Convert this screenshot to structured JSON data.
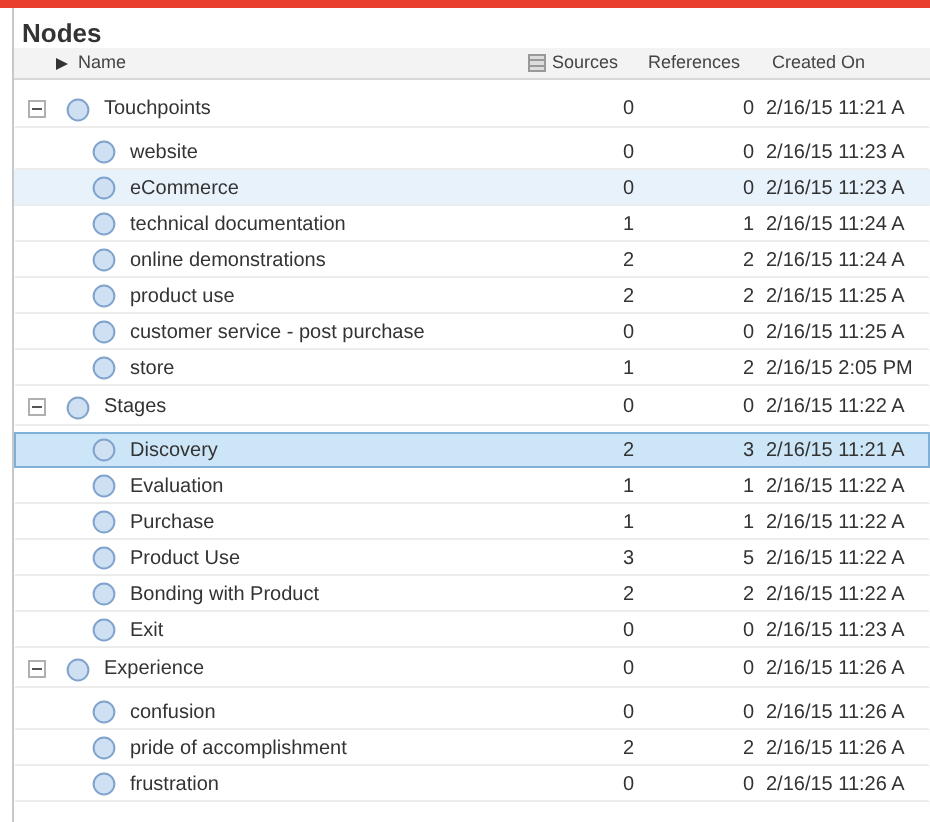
{
  "title": "Nodes",
  "columns": [
    {
      "label": "Name",
      "sorted": true
    },
    {
      "label": "Sources",
      "sorted": false
    },
    {
      "label": "References",
      "sorted": false
    },
    {
      "label": "Created On",
      "sorted": false
    }
  ],
  "groups": [
    {
      "name": "Touchpoints",
      "sources": "0",
      "references": "0",
      "created": "2/16/15 11:21 A",
      "expanded": true,
      "selected": false,
      "hovered": false,
      "children": [
        {
          "name": "website",
          "sources": "0",
          "references": "0",
          "created": "2/16/15 11:23 A",
          "selected": false,
          "hovered": false
        },
        {
          "name": "eCommerce",
          "sources": "0",
          "references": "0",
          "created": "2/16/15 11:23 A",
          "selected": false,
          "hovered": true
        },
        {
          "name": "technical documentation",
          "sources": "1",
          "references": "1",
          "created": "2/16/15 11:24 A",
          "selected": false,
          "hovered": false
        },
        {
          "name": "online demonstrations",
          "sources": "2",
          "references": "2",
          "created": "2/16/15 11:24 A",
          "selected": false,
          "hovered": false
        },
        {
          "name": "product use",
          "sources": "2",
          "references": "2",
          "created": "2/16/15 11:25 A",
          "selected": false,
          "hovered": false
        },
        {
          "name": "customer service - post purchase",
          "sources": "0",
          "references": "0",
          "created": "2/16/15 11:25 A",
          "selected": false,
          "hovered": false
        },
        {
          "name": "store",
          "sources": "1",
          "references": "2",
          "created": "2/16/15 2:05 PM",
          "selected": false,
          "hovered": false
        }
      ]
    },
    {
      "name": "Stages",
      "sources": "0",
      "references": "0",
      "created": "2/16/15 11:22 A",
      "expanded": true,
      "selected": false,
      "hovered": false,
      "children": [
        {
          "name": "Discovery",
          "sources": "2",
          "references": "3",
          "created": "2/16/15 11:21 A",
          "selected": true,
          "hovered": false
        },
        {
          "name": "Evaluation",
          "sources": "1",
          "references": "1",
          "created": "2/16/15 11:22 A",
          "selected": false,
          "hovered": false
        },
        {
          "name": "Purchase",
          "sources": "1",
          "references": "1",
          "created": "2/16/15 11:22 A",
          "selected": false,
          "hovered": false
        },
        {
          "name": "Product Use",
          "sources": "3",
          "references": "5",
          "created": "2/16/15 11:22 A",
          "selected": false,
          "hovered": false
        },
        {
          "name": "Bonding with Product",
          "sources": "2",
          "references": "2",
          "created": "2/16/15 11:22 A",
          "selected": false,
          "hovered": false
        },
        {
          "name": "Exit",
          "sources": "0",
          "references": "0",
          "created": "2/16/15 11:23 A",
          "selected": false,
          "hovered": false
        }
      ]
    },
    {
      "name": "Experience",
      "sources": "0",
      "references": "0",
      "created": "2/16/15 11:26 A",
      "expanded": true,
      "selected": false,
      "hovered": false,
      "children": [
        {
          "name": "confusion",
          "sources": "0",
          "references": "0",
          "created": "2/16/15 11:26 A",
          "selected": false,
          "hovered": false
        },
        {
          "name": "pride of accomplishment",
          "sources": "2",
          "references": "2",
          "created": "2/16/15 11:26 A",
          "selected": false,
          "hovered": false
        },
        {
          "name": "frustration",
          "sources": "0",
          "references": "0",
          "created": "2/16/15 11:26 A",
          "selected": false,
          "hovered": false
        }
      ]
    }
  ]
}
